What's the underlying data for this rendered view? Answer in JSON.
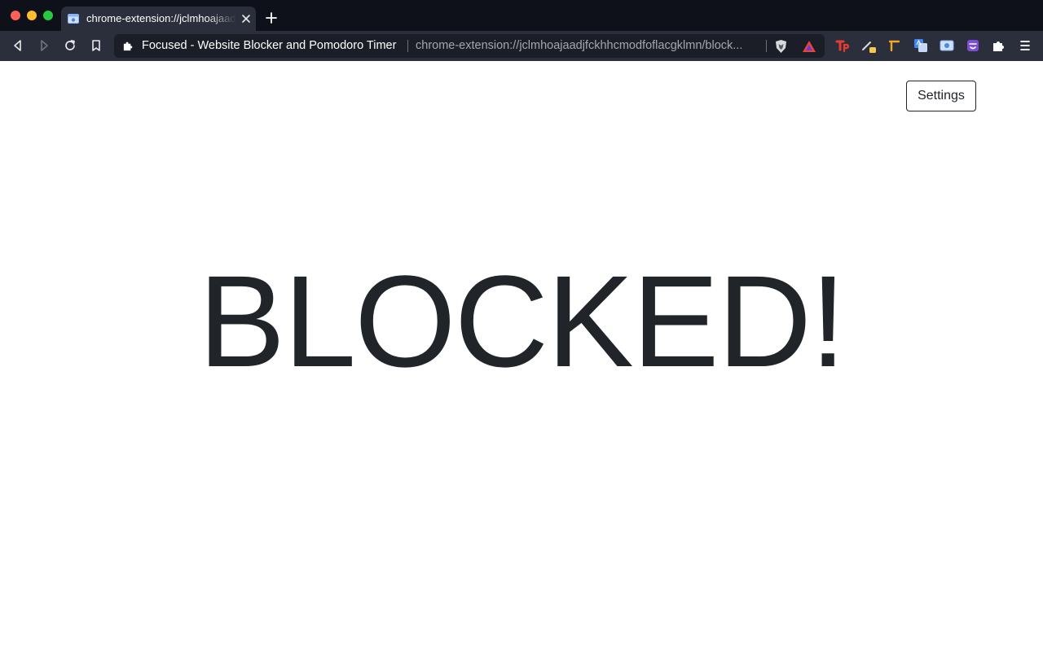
{
  "browser": {
    "tab": {
      "title": "chrome-extension://jclmhoajaadjfckhhcmodfoflacgklmn/blocked.html",
      "favicon_icon": "extension-page-icon"
    },
    "new_tab_icon": "plus-icon",
    "toolbar": {
      "back_icon": "back-icon",
      "forward_icon": "forward-icon",
      "reload_icon": "reload-icon",
      "bookmark_icon": "bookmark-icon"
    },
    "omnibox": {
      "site_icon": "puzzle-piece-icon",
      "page_title": "Focused - Website Blocker and Pomodoro Timer",
      "url": "chrome-extension://jclmhoajaadjfckhhcmodfoflacgklmn/block..."
    },
    "extensions": [
      "brave-shields-icon",
      "brave-rewards-icon",
      "tp-icon",
      "pencil-badge-icon",
      "hammer-icon",
      "translate-icon",
      "screenshot-icon",
      "monster-icon",
      "puzzle-piece-icon",
      "menu-icon"
    ]
  },
  "page": {
    "settings_label": "Settings",
    "headline": "BLOCKED!"
  },
  "colors": {
    "titlebar": "#0f111a",
    "toolbar": "#2b2e3b",
    "omnibox": "#1b1d27",
    "text_dark": "#212529"
  }
}
